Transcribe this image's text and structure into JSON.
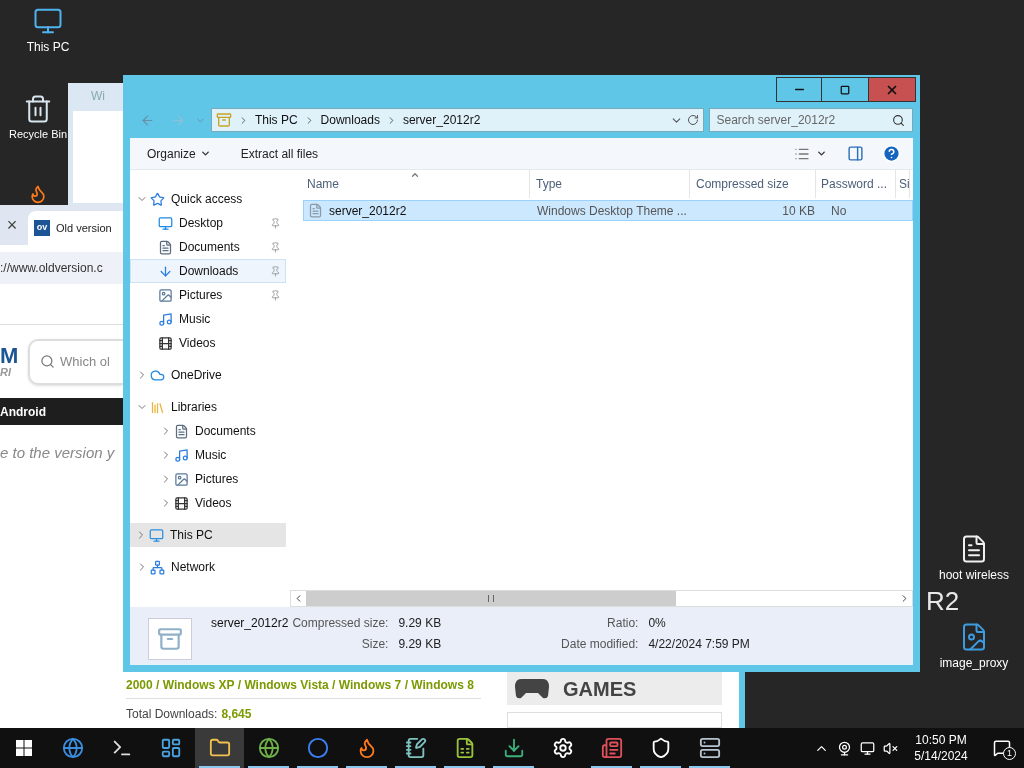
{
  "desktop": {
    "icons": [
      {
        "label": "This PC"
      },
      {
        "label": "Recycle Bin"
      },
      {
        "label": "hoot wireless"
      },
      {
        "label": "image_proxy"
      }
    ],
    "wallpaper_text": "R2"
  },
  "background_window": {
    "title": "Wi"
  },
  "browser": {
    "tab_close": "×",
    "tab": {
      "favicon": "ov",
      "title": "Old version"
    },
    "address": "://www.oldversion.c",
    "search_placeholder": "Which ol",
    "logo": {
      "letter": "M",
      "tagline": "RI"
    },
    "nav": [
      "Android"
    ],
    "intro": "e to the version y",
    "works_on": "2000 / Windows XP / Windows Vista / Windows 7 / Windows 8",
    "total_downloads": {
      "label": "Total Downloads:",
      "value": "8,645"
    },
    "category": "GAMES"
  },
  "explorer": {
    "breadcrumb": [
      "This PC",
      "Downloads",
      "server_2012r2"
    ],
    "search_placeholder": "Search server_2012r2",
    "toolbar": [
      {
        "label": "Organize",
        "menu": true
      },
      {
        "label": "Extract all files",
        "menu": false
      }
    ],
    "nav": [
      {
        "label": "Quick access",
        "expanded": true,
        "selected": false,
        "children": [
          {
            "label": "Desktop",
            "pinned": true,
            "selected": false
          },
          {
            "label": "Documents",
            "pinned": true,
            "selected": false
          },
          {
            "label": "Downloads",
            "pinned": true,
            "selected": true
          },
          {
            "label": "Pictures",
            "pinned": true,
            "selected": false
          },
          {
            "label": "Music",
            "pinned": false,
            "selected": false
          },
          {
            "label": "Videos",
            "pinned": false,
            "selected": false
          }
        ]
      },
      {
        "label": "OneDrive",
        "expanded": false,
        "selected": false
      },
      {
        "label": "Libraries",
        "expanded": true,
        "selected": false,
        "children": [
          {
            "label": "Documents",
            "expanded": false,
            "selected": false
          },
          {
            "label": "Music",
            "expanded": false,
            "selected": false
          },
          {
            "label": "Pictures",
            "expanded": false,
            "selected": false
          },
          {
            "label": "Videos",
            "expanded": false,
            "selected": false
          }
        ]
      },
      {
        "label": "This PC",
        "expanded": false,
        "selected": true
      },
      {
        "label": "Network",
        "expanded": false,
        "selected": false
      }
    ],
    "columns": [
      {
        "label": "Name",
        "sorted": true
      },
      {
        "label": "Type",
        "sorted": false
      },
      {
        "label": "Compressed size",
        "sorted": false
      },
      {
        "label": "Password ...",
        "sorted": false
      },
      {
        "label": "Si",
        "sorted": false
      }
    ],
    "rows": [
      {
        "selected": true,
        "cells": [
          "server_2012r2",
          "Windows Desktop Theme ...",
          "10 KB",
          "No"
        ]
      }
    ],
    "details": {
      "name": "server_2012r2",
      "fields": [
        {
          "label": "Compressed size:",
          "value": "9.29 KB"
        },
        {
          "label": "Size:",
          "value": "9.29 KB"
        },
        {
          "label": "Ratio:",
          "value": "0%"
        },
        {
          "label": "Date modified:",
          "value": "4/22/2024 7:59 PM"
        }
      ]
    }
  },
  "taskbar": {
    "apps": [
      {
        "running": false,
        "active": false
      },
      {
        "running": false,
        "active": false
      },
      {
        "running": false,
        "active": false
      },
      {
        "running": true,
        "active": true
      },
      {
        "running": true,
        "active": false
      },
      {
        "running": true,
        "active": false
      },
      {
        "running": true,
        "active": false
      },
      {
        "running": true,
        "active": false
      },
      {
        "running": true,
        "active": false
      },
      {
        "running": true,
        "active": false
      },
      {
        "running": false,
        "active": false
      },
      {
        "running": true,
        "active": false
      },
      {
        "running": true,
        "active": false
      },
      {
        "running": true,
        "active": false
      }
    ],
    "time": "10:50 PM",
    "date": "5/14/2024",
    "notification_count": "1"
  }
}
